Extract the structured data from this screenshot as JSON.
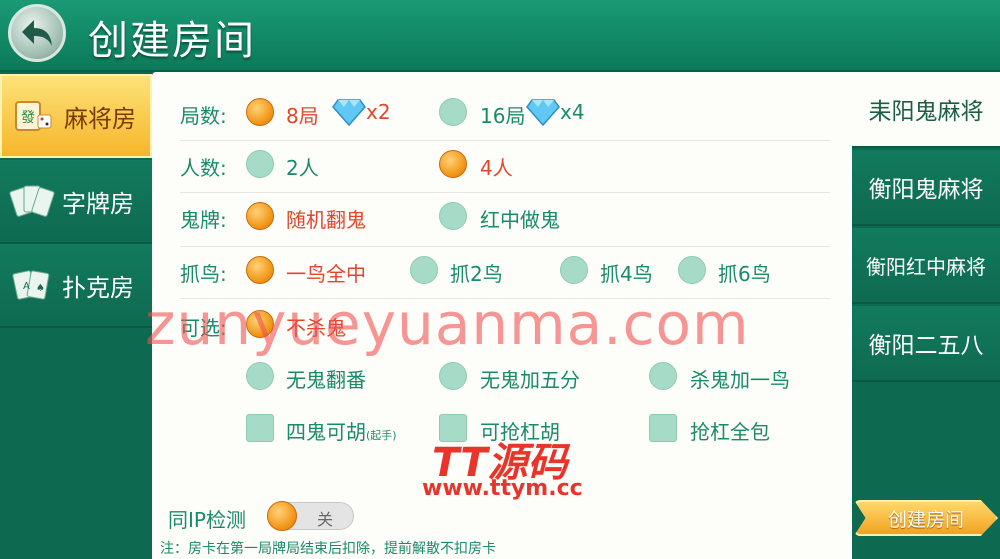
{
  "header": {
    "title": "创建房间"
  },
  "sidebar": {
    "items": [
      {
        "label": "麻将房",
        "icon": "mahjong-tile-icon",
        "active": true
      },
      {
        "label": "字牌房",
        "icon": "word-cards-icon",
        "active": false
      },
      {
        "label": "扑克房",
        "icon": "poker-cards-icon",
        "active": false
      }
    ]
  },
  "rounds": {
    "label": "局数:",
    "options": [
      {
        "label": "8局",
        "cost": "x2",
        "selected": true
      },
      {
        "label": "16局",
        "cost": "x4",
        "selected": false
      }
    ]
  },
  "players": {
    "label": "人数:",
    "options": [
      {
        "label": "2人",
        "selected": false
      },
      {
        "label": "4人",
        "selected": true
      }
    ]
  },
  "ghost": {
    "label": "鬼牌:",
    "options": [
      {
        "label": "随机翻鬼",
        "selected": true
      },
      {
        "label": "红中做鬼",
        "selected": false
      }
    ]
  },
  "bird": {
    "label": "抓鸟:",
    "options": [
      {
        "label": "一鸟全中",
        "selected": true
      },
      {
        "label": "抓2鸟",
        "selected": false
      },
      {
        "label": "抓4鸟",
        "selected": false
      },
      {
        "label": "抓6鸟",
        "selected": false
      }
    ]
  },
  "optional": {
    "label": "可选:",
    "options": [
      {
        "label": "不杀鬼",
        "selected": true
      },
      {
        "label": "无鬼翻番",
        "selected": false
      },
      {
        "label": "无鬼加五分",
        "selected": false
      },
      {
        "label": "杀鬼加一鸟",
        "selected": false
      }
    ],
    "checks": [
      {
        "label": "四鬼可胡",
        "sub": "(起手)",
        "checked": false
      },
      {
        "label": "可抢杠胡",
        "checked": false
      },
      {
        "label": "抢杠全包",
        "checked": false
      }
    ]
  },
  "ip_check": {
    "label": "同IP检测",
    "state": "关"
  },
  "note": "注：房卡在第一局牌局结束后扣除，提前解散不扣房卡",
  "right_tabs": [
    {
      "label": "耒阳鬼麻将",
      "active": true
    },
    {
      "label": "衡阳鬼麻将",
      "active": false
    },
    {
      "label": "衡阳红中麻将",
      "active": false
    },
    {
      "label": "衡阳二五八",
      "active": false
    }
  ],
  "create_button": "创建房间",
  "watermark": {
    "site": "zunyueyuanma.com",
    "brand": "TT源码",
    "url": "www.ttym.cc"
  },
  "colors": {
    "header_green": "#1a9a74",
    "label_green": "#1b8a6a",
    "selected_red": "#e2462b",
    "radio_orange": "#f39a1b",
    "radio_off": "#a6dbc8"
  }
}
